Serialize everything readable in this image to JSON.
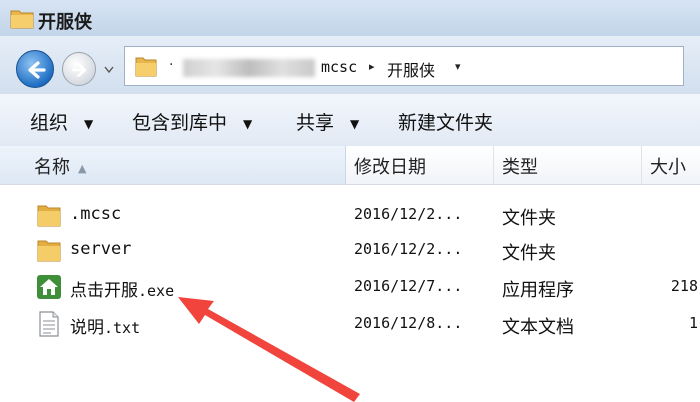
{
  "window": {
    "title": "开服侠"
  },
  "address": {
    "sep": "·",
    "crumbs": [
      "mcsc",
      "开服侠"
    ],
    "arrow": "▸"
  },
  "toolbar": {
    "organize": "组织",
    "include_in_library": "包含到库中",
    "share": "共享",
    "new_folder": "新建文件夹"
  },
  "columns": {
    "name": "名称",
    "date": "修改日期",
    "type": "类型",
    "size": "大小"
  },
  "files": [
    {
      "name": ".mcsc",
      "date": "2016/12/2...",
      "type": "文件夹",
      "size": "",
      "icon": "folder-icon"
    },
    {
      "name": "server",
      "date": "2016/12/2...",
      "type": "文件夹",
      "size": "",
      "icon": "folder-icon"
    },
    {
      "name_cn": "点击开服",
      "name_ext": ".exe",
      "date": "2016/12/7...",
      "type": "应用程序",
      "size": "218",
      "icon": "app-icon"
    },
    {
      "name_cn": "说明",
      "name_ext": ".txt",
      "date": "2016/12/8...",
      "type": "文本文档",
      "size": "1",
      "icon": "text-file-icon"
    }
  ],
  "colors": {
    "arrow": "#f0443c",
    "accent": "#1f6fc4"
  }
}
